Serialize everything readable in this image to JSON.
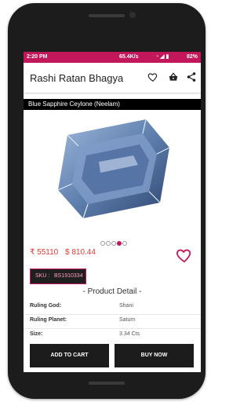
{
  "status_bar": {
    "time": "2:20 PM",
    "network_speed": "65.4K/s",
    "battery": "82%"
  },
  "app_bar": {
    "title": "Rashi Ratan Bhagya",
    "icons": [
      "heart-icon",
      "basket-icon",
      "share-icon"
    ]
  },
  "product": {
    "name": "Blue Sapphire Ceylone (Neelam)",
    "image_icon": "gem-image",
    "carousel_total": 5,
    "carousel_active": 4,
    "price_inr": "₹ 55110",
    "price_usd": "$ 810.44",
    "sku_label": "SKU :",
    "sku_value": "BS1910334"
  },
  "product_detail": {
    "title": "- Product Detail -",
    "rows": [
      {
        "key": "Ruling God:",
        "value": "Shani"
      },
      {
        "key": "Ruling Planet:",
        "value": "Saturn"
      },
      {
        "key": "Size:",
        "value": "3.34 Cts"
      }
    ]
  },
  "actions": {
    "add_to_cart": "ADD TO CART",
    "buy_now": "BUY NOW"
  },
  "colors": {
    "accent": "#c2185b",
    "price": "#e53935",
    "dark": "#1c1c1c"
  }
}
